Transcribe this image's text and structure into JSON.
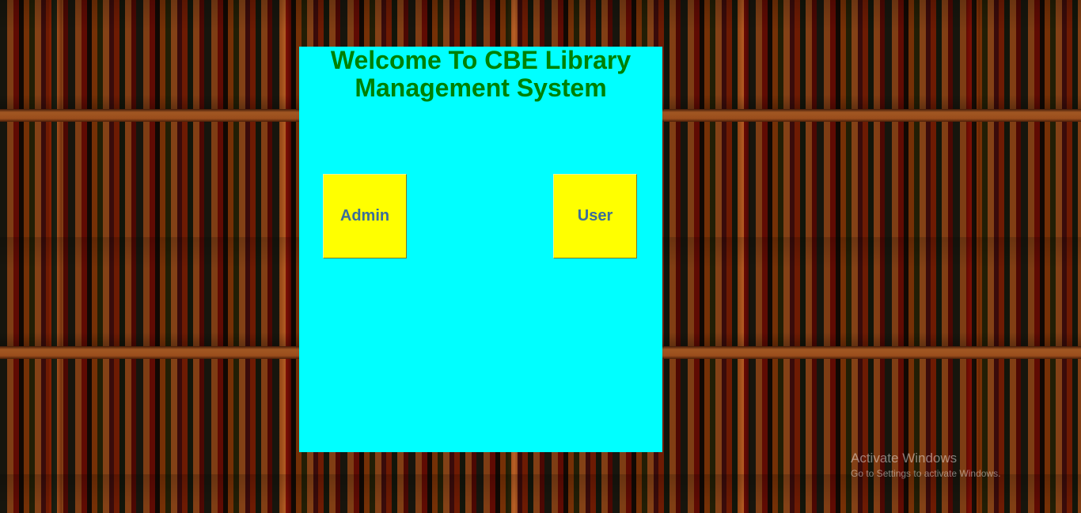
{
  "header": {
    "title_line1": "Welcome To CBE Library",
    "title_line2": "Management System"
  },
  "buttons": {
    "admin_label": "Admin",
    "user_label": "User"
  },
  "watermark": {
    "title": "Activate Windows",
    "subtitle": "Go to Settings to activate Windows."
  },
  "colors": {
    "panel_background": "#00ffff",
    "title_text": "#008000",
    "button_background": "#ffff00",
    "button_text": "#3b6d9a"
  }
}
